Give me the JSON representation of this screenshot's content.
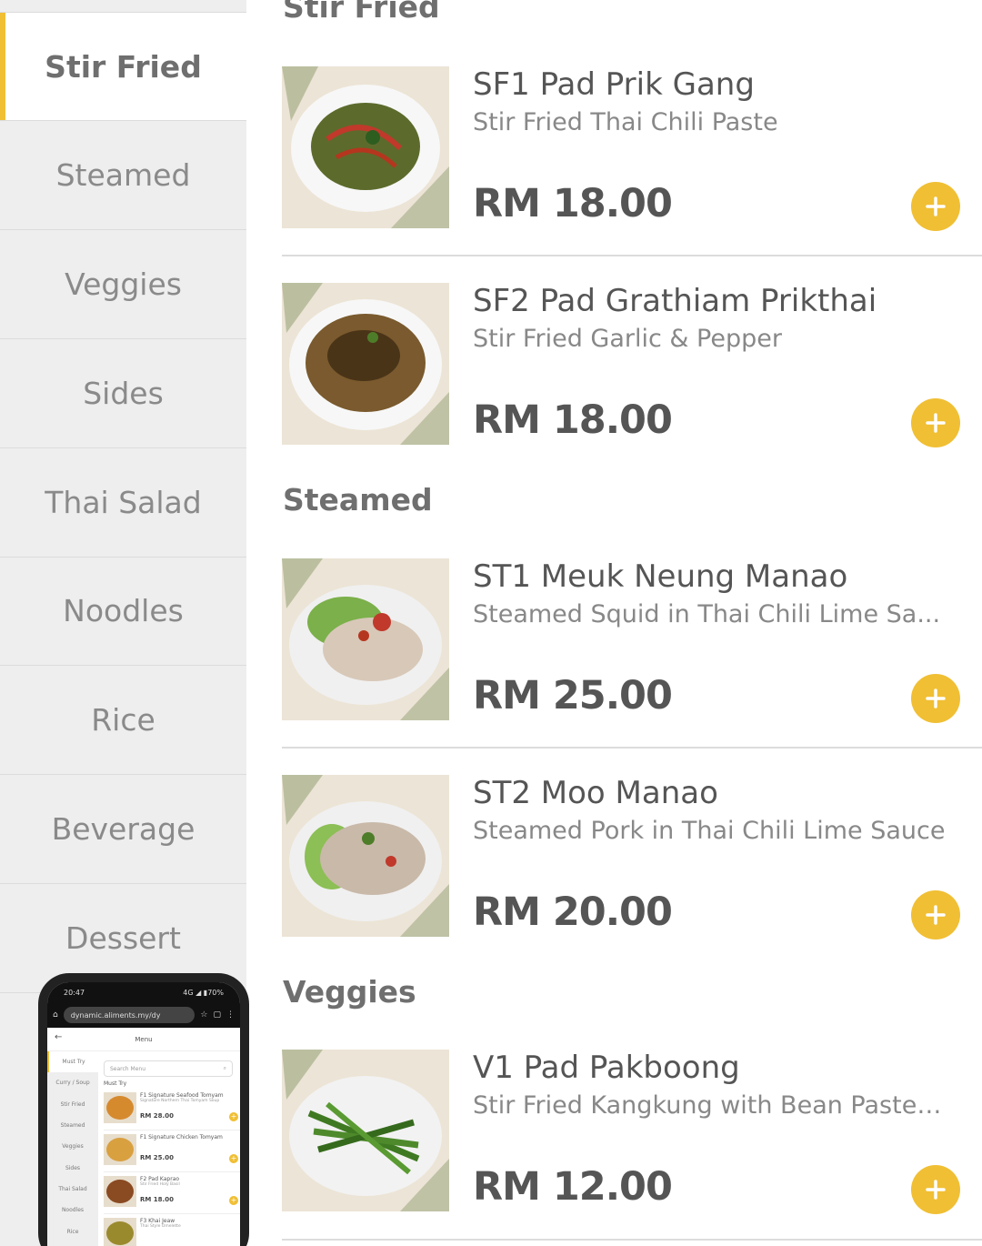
{
  "sidebar": {
    "categories": [
      {
        "label": "Stir Fried",
        "active": true
      },
      {
        "label": "Steamed",
        "active": false
      },
      {
        "label": "Veggies",
        "active": false
      },
      {
        "label": "Sides",
        "active": false
      },
      {
        "label": "Thai Salad",
        "active": false
      },
      {
        "label": "Noodles",
        "active": false
      },
      {
        "label": "Rice",
        "active": false
      },
      {
        "label": "Beverage",
        "active": false
      },
      {
        "label": "Dessert",
        "active": false
      }
    ]
  },
  "menu": {
    "sections": [
      {
        "title": "Stir Fried",
        "items": [
          {
            "name": "SF1 Pad Prik Gang",
            "desc": "Stir Fried Thai Chili Paste",
            "price": "RM 18.00"
          },
          {
            "name": "SF2 Pad Grathiam Prikthai",
            "desc": "Stir Fried Garlic & Pepper",
            "price": "RM 18.00"
          }
        ]
      },
      {
        "title": "Steamed",
        "items": [
          {
            "name": "ST1 Meuk Neung Manao",
            "desc": "Steamed Squid in Thai Chili Lime Sa...",
            "price": "RM 25.00"
          },
          {
            "name": "ST2 Moo Manao",
            "desc": "Steamed Pork in Thai Chili Lime Sauce",
            "price": "RM 20.00"
          }
        ]
      },
      {
        "title": "Veggies",
        "items": [
          {
            "name": "V1 Pad Pakboong",
            "desc": "Stir Fried Kangkung with Bean Paste ...",
            "price": "RM 12.00"
          }
        ]
      }
    ]
  },
  "phone_preview": {
    "status_time": "20:47",
    "status_right": "4G ◢ ▮70%",
    "url": "dynamic.aliments.my/dy",
    "page_title": "Menu",
    "search_placeholder": "Search Menu",
    "section": "Must Try",
    "side": [
      "Must Try",
      "Curry / Soup",
      "Stir Fried",
      "Steamed",
      "Veggies",
      "Sides",
      "Thai Salad",
      "Noodles",
      "Rice"
    ],
    "items": [
      {
        "name": "F1 Signature Seafood Tomyam",
        "desc": "Signature Northern Thai Tomyam Soup",
        "price": "RM 28.00"
      },
      {
        "name": "F1 Signature Chicken Tomyam",
        "desc": "",
        "price": "RM 25.00"
      },
      {
        "name": "F2 Pad Kaprao",
        "desc": "Stir Fried Holy Basil",
        "price": "RM 18.00"
      },
      {
        "name": "F3 Khai Jeaw",
        "desc": "Thai Style Omelette",
        "price": ""
      }
    ]
  },
  "colors": {
    "accent": "#f0bf34",
    "sidebar_bg": "#eeeeee",
    "text_dark": "#555555"
  },
  "icons": {
    "add": "plus-icon"
  }
}
